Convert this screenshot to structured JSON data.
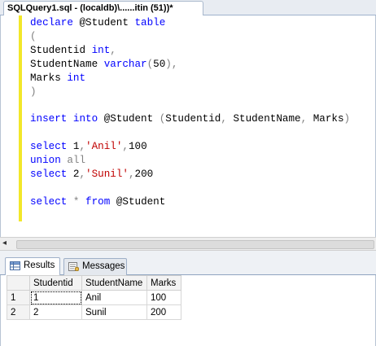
{
  "document_tab": {
    "title": "SQLQuery1.sql - (localdb)\\......itin (51))*"
  },
  "editor": {
    "line1": {
      "a": "declare",
      "b": " @Student ",
      "c": "table"
    },
    "line2": {
      "a": "("
    },
    "line3": {
      "a": "Studentid ",
      "b": "int",
      "c": ","
    },
    "line4": {
      "a": "StudentName ",
      "b": "varchar",
      "c": "(",
      "d": "50",
      "e": "),"
    },
    "line5": {
      "a": "Marks ",
      "b": "int"
    },
    "line6": {
      "a": ")"
    },
    "line7": {
      "a": "insert",
      "b": " ",
      "c": "into",
      "d": " @Student ",
      "e": "(",
      "f": "Studentid",
      "g": ",",
      "h": " StudentName",
      "i": ",",
      "j": " Marks",
      "k": ")"
    },
    "line8": {
      "a": "select",
      "b": " 1",
      "c": ",",
      "d": "'Anil'",
      "e": ",",
      "f": "100"
    },
    "line9": {
      "a": "union",
      "b": " ",
      "c": "all"
    },
    "line10": {
      "a": "select",
      "b": " 2",
      "c": ",",
      "d": "'Sunil'",
      "e": ",",
      "f": "200"
    },
    "line11": {
      "a": "select",
      "b": " ",
      "c": "*",
      "d": " ",
      "e": "from",
      "f": " @Student"
    }
  },
  "results_tabs": {
    "results_label": "Results",
    "messages_label": "Messages"
  },
  "grid": {
    "columns": [
      "Studentid",
      "StudentName",
      "Marks"
    ],
    "rows": [
      {
        "num": "1",
        "cells": [
          "1",
          "Anil",
          "100"
        ]
      },
      {
        "num": "2",
        "cells": [
          "2",
          "Sunil",
          "200"
        ]
      }
    ]
  },
  "colors": {
    "keyword": "#0000ff",
    "operator": "#808080",
    "string": "#c00000",
    "change_bar": "#f2e72a"
  },
  "icons": {
    "results_tab": "grid-icon",
    "messages_tab": "messages-icon",
    "scroll_left": "scroll-left-arrow"
  }
}
